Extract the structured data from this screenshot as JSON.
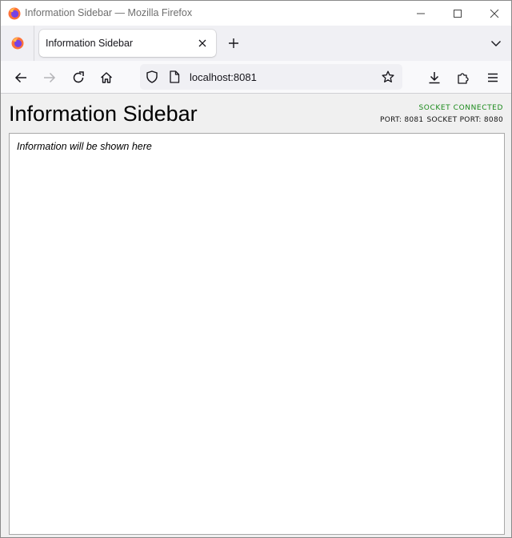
{
  "window": {
    "title": "Information Sidebar — Mozilla Firefox"
  },
  "tabs": [
    {
      "label": "Information Sidebar",
      "active": true
    }
  ],
  "navbar": {
    "url": "localhost:8081"
  },
  "page": {
    "heading": "Information Sidebar",
    "socket_status": "SOCKET CONNECTED",
    "socket_status_color": "#1a8a1a",
    "port_label": "PORT: 8081",
    "socket_port_label": "SOCKET PORT: 8080",
    "info_placeholder": "Information will be shown here"
  },
  "icons": {
    "app": "firefox-icon",
    "minimize": "minimize-icon",
    "maximize": "maximize-icon",
    "close": "close-icon",
    "new_tab": "plus-icon",
    "tab_list": "chevron-down-icon",
    "back": "arrow-left-icon",
    "forward": "arrow-right-icon",
    "reload": "reload-icon",
    "home": "home-icon",
    "tracking": "shield-icon",
    "page_info": "page-icon",
    "bookmark": "star-icon",
    "downloads": "download-icon",
    "extensions": "puzzle-icon",
    "menu": "hamburger-icon"
  }
}
